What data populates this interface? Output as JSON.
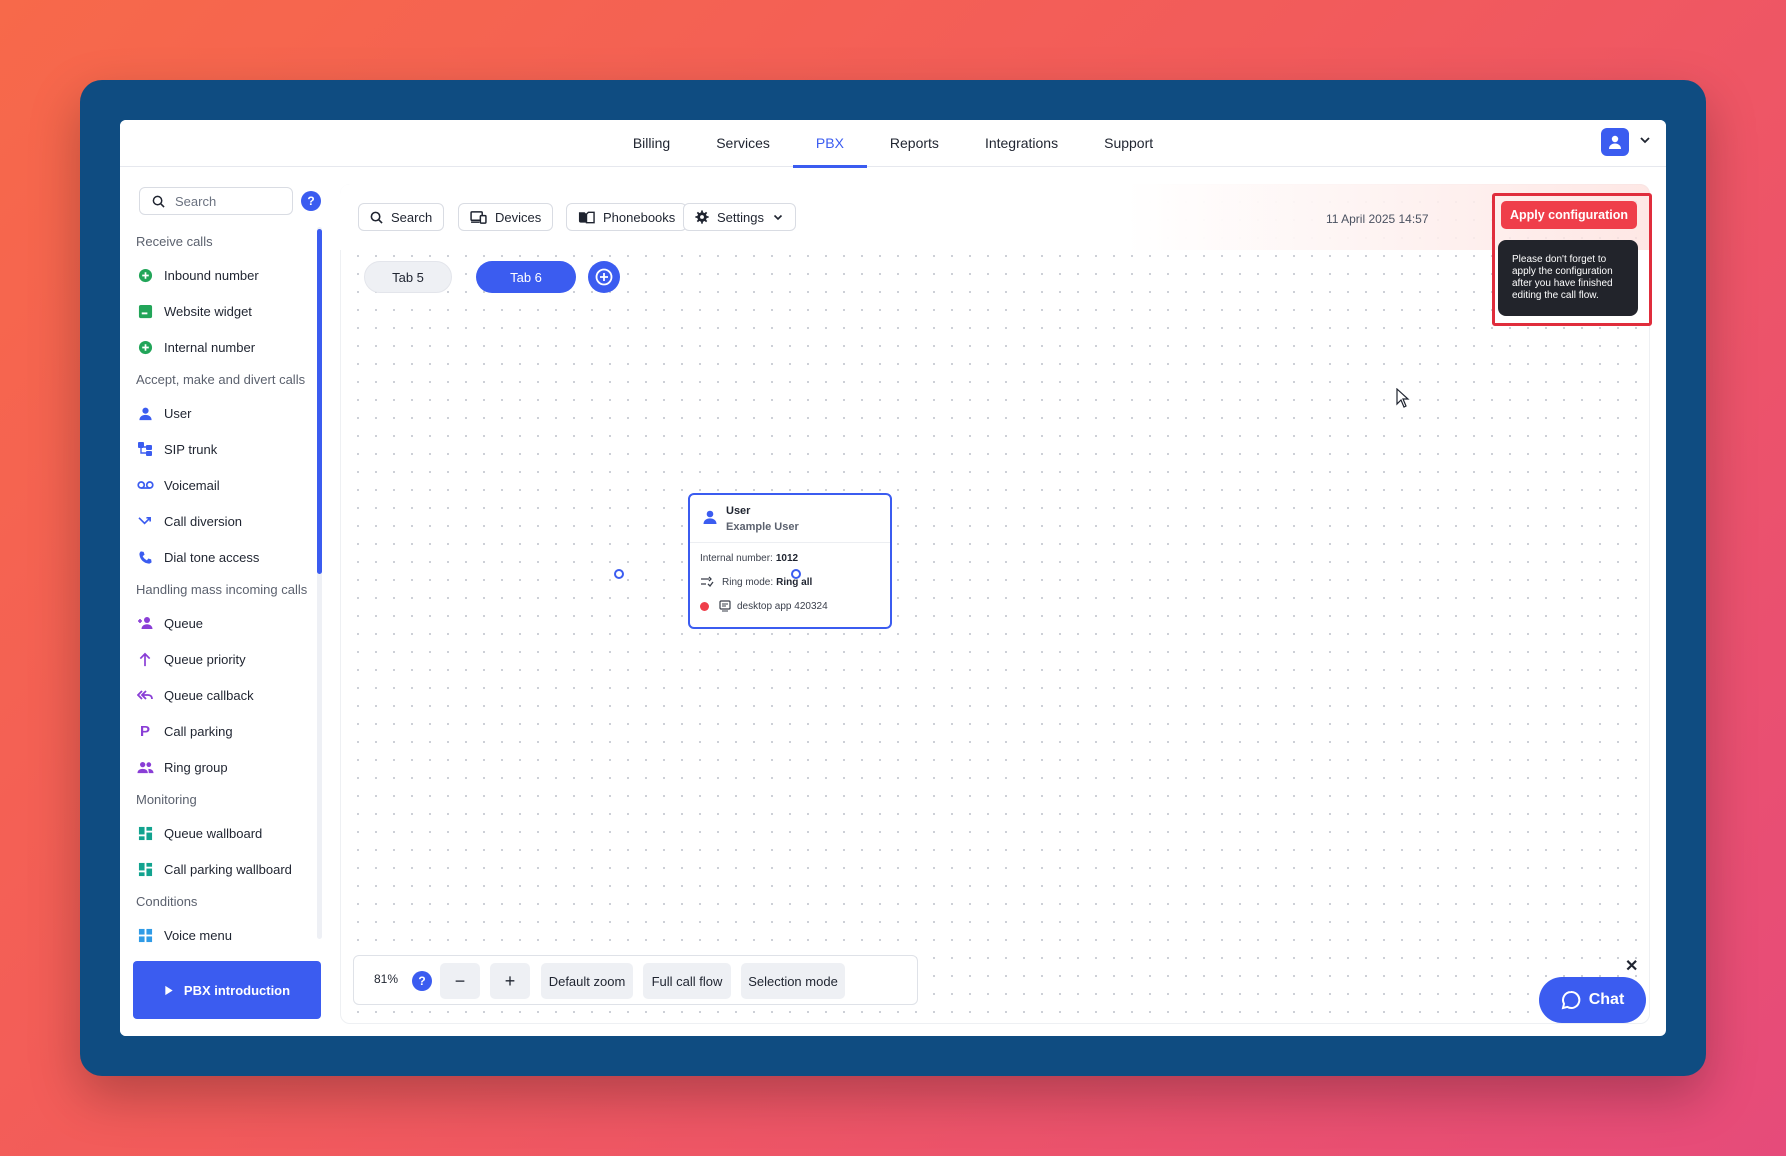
{
  "nav": {
    "items": [
      {
        "label": "Billing",
        "active": false
      },
      {
        "label": "Services",
        "active": false
      },
      {
        "label": "PBX",
        "active": true
      },
      {
        "label": "Reports",
        "active": false
      },
      {
        "label": "Integrations",
        "active": false
      },
      {
        "label": "Support",
        "active": false
      }
    ]
  },
  "sidebar": {
    "search_placeholder": "Search",
    "help": "?",
    "sections": [
      {
        "title": "Receive calls",
        "items": [
          {
            "label": "Inbound number",
            "icon": "plus-circle-icon",
            "color": "#22a559"
          },
          {
            "label": "Website widget",
            "icon": "widget-icon",
            "color": "#22a559"
          },
          {
            "label": "Internal number",
            "icon": "plus-circle-icon",
            "color": "#22a559"
          }
        ]
      },
      {
        "title": "Accept, make and divert calls",
        "items": [
          {
            "label": "User",
            "icon": "user-icon",
            "color": "#3b5cf0"
          },
          {
            "label": "SIP trunk",
            "icon": "sip-trunk-icon",
            "color": "#3b5cf0"
          },
          {
            "label": "Voicemail",
            "icon": "voicemail-icon",
            "color": "#3b5cf0"
          },
          {
            "label": "Call diversion",
            "icon": "diversion-icon",
            "color": "#3b5cf0"
          },
          {
            "label": "Dial tone access",
            "icon": "phone-icon",
            "color": "#3b5cf0"
          }
        ]
      },
      {
        "title": "Handling mass incoming calls",
        "items": [
          {
            "label": "Queue",
            "icon": "queue-icon",
            "color": "#8a3ed6"
          },
          {
            "label": "Queue priority",
            "icon": "arrow-up-icon",
            "color": "#8a3ed6"
          },
          {
            "label": "Queue callback",
            "icon": "callback-icon",
            "color": "#8a3ed6"
          },
          {
            "label": "Call parking",
            "icon": "parking-icon",
            "color": "#8a3ed6"
          },
          {
            "label": "Ring group",
            "icon": "group-icon",
            "color": "#8a3ed6"
          }
        ]
      },
      {
        "title": "Monitoring",
        "items": [
          {
            "label": "Queue wallboard",
            "icon": "wallboard-icon",
            "color": "#12a38f"
          },
          {
            "label": "Call parking wallboard",
            "icon": "wallboard-icon",
            "color": "#12a38f"
          }
        ]
      },
      {
        "title": "Conditions",
        "items": [
          {
            "label": "Voice menu",
            "icon": "voice-menu-icon",
            "color": "#2f9be6"
          }
        ]
      }
    ],
    "intro_button": "PBX introduction"
  },
  "toolbar": {
    "search": "Search",
    "devices": "Devices",
    "phonebooks": "Phonebooks",
    "settings": "Settings",
    "datetime": "11 April 2025 14:57",
    "apply": "Apply configuration",
    "tooltip": "Please don't forget to apply the configuration after you have finished editing the call flow."
  },
  "tabs": [
    {
      "label": "Tab 5",
      "active": false
    },
    {
      "label": "Tab 6",
      "active": true
    }
  ],
  "node": {
    "title": "User",
    "subtitle": "Example User",
    "internal_label": "Internal number:",
    "internal_value": "1012",
    "ring_label": "Ring mode:",
    "ring_value": "Ring all",
    "device": "desktop app 420324"
  },
  "zoom": {
    "level": "81%",
    "help": "?",
    "minus": "−",
    "plus": "+",
    "default": "Default zoom",
    "full": "Full call flow",
    "selection": "Selection mode"
  },
  "chat": {
    "label": "Chat",
    "close": "✕"
  },
  "colors": {
    "accent": "#3b5cf0",
    "danger": "#ef3e4a"
  }
}
